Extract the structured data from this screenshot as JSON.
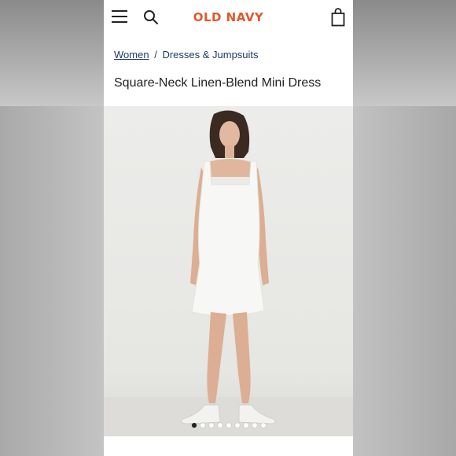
{
  "header": {
    "logo_text": "OLD NAVY",
    "menu_icon": "hamburger-menu-icon",
    "search_icon": "search-icon",
    "bag_icon": "shopping-bag-icon",
    "logo_color": "#e4572a"
  },
  "breadcrumb": {
    "items": [
      {
        "label": "Women"
      },
      {
        "label": "Dresses & Jumpsuits"
      }
    ],
    "separator": "/"
  },
  "product": {
    "title": "Square-Neck Linen-Blend Mini Dress"
  },
  "carousel": {
    "dot_count": 9,
    "active_index": 0
  }
}
